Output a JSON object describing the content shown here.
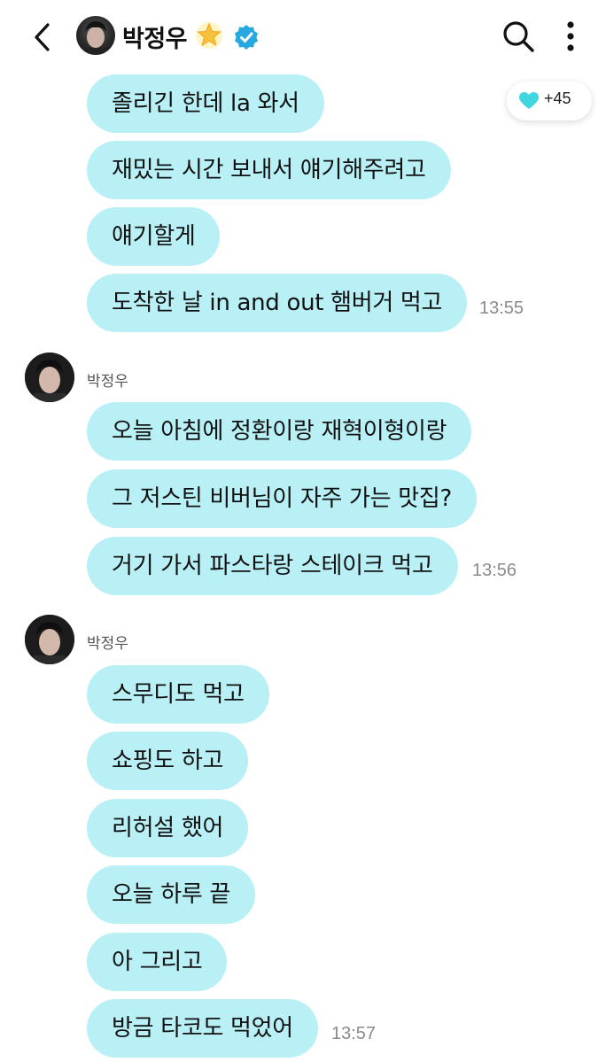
{
  "header": {
    "title": "박정우",
    "back_icon": "chevron-left-icon",
    "star_icon": "glowing-star-icon",
    "verified_icon": "verified-badge-icon",
    "search_icon": "search-icon",
    "menu_icon": "more-vertical-icon"
  },
  "reaction": {
    "icon": "heart-icon",
    "count": "+45",
    "color": "#3fd6e0"
  },
  "groups": [
    {
      "messages": [
        "졸리긴 한데 la 와서",
        "재밌는 시간 보내서 얘기해주려고",
        "얘기할게",
        "도착한 날 in and out 햄버거 먹고"
      ],
      "time": "13:55"
    },
    {
      "sender": "박정우",
      "messages": [
        "오늘 아침에 정환이랑 재혁이형이랑",
        "그 저스틴 비버님이 자주 가는 맛집?",
        "거기 가서 파스타랑 스테이크 먹고"
      ],
      "time": "13:56"
    },
    {
      "sender": "박정우",
      "messages": [
        "스무디도 먹고",
        "쇼핑도 하고",
        "리허설 했어",
        "오늘 하루 끝",
        "아 그리고",
        "방금 타코도 먹었어"
      ],
      "time": "13:57"
    }
  ],
  "colors": {
    "bubble": "#b8f0f6",
    "verified": "#27a9e0"
  }
}
